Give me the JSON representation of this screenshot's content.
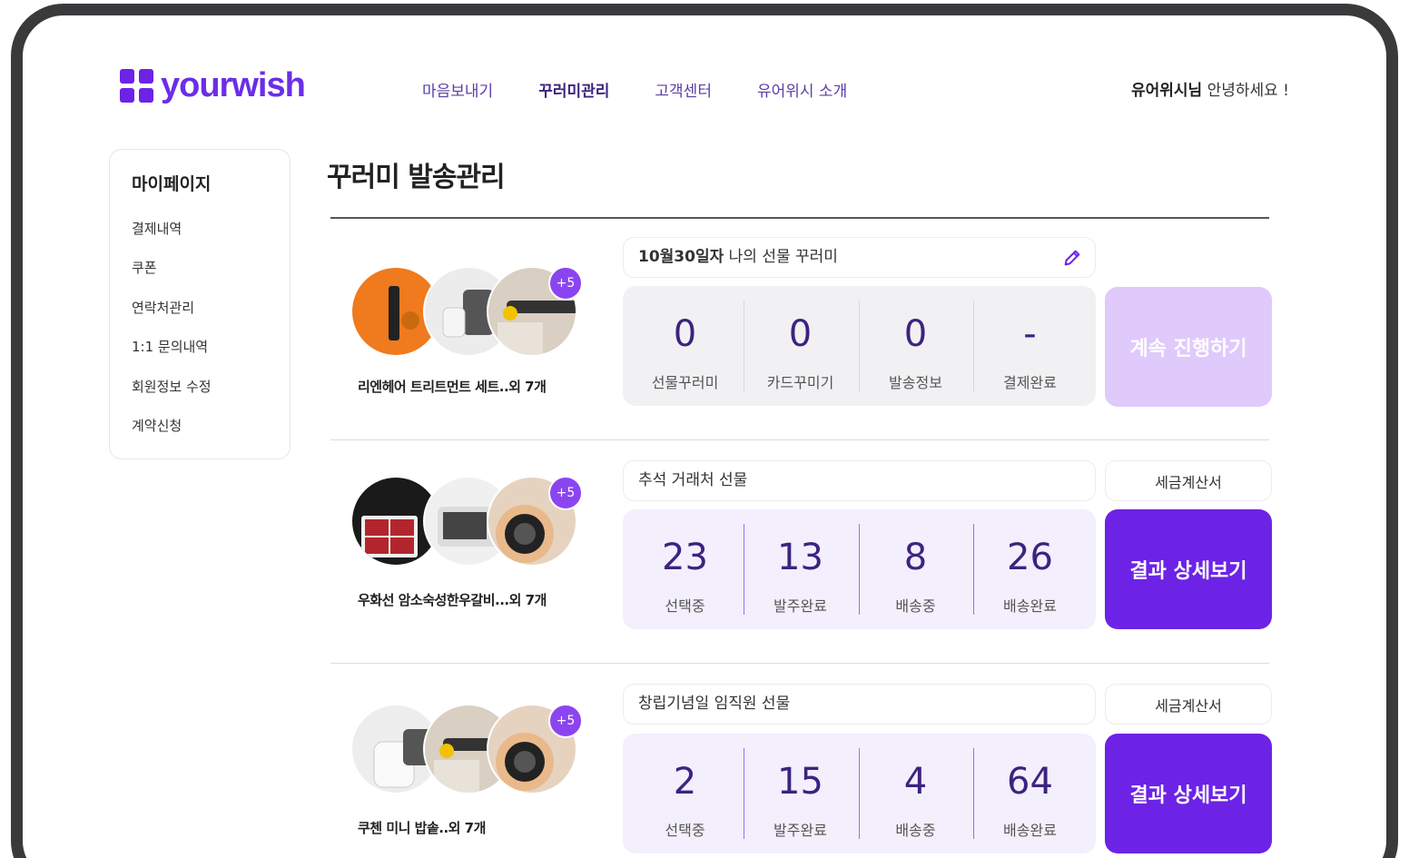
{
  "brand": {
    "name": "yourwish",
    "accent": "#6c23e6",
    "light_accent": "#e0c9fb"
  },
  "nav": {
    "items": [
      "마음보내기",
      "꾸러미관리",
      "고객센터",
      "유어위시 소개"
    ],
    "active": "꾸러미관리"
  },
  "greeting": {
    "name": "유어위시님",
    "text": "안녕하세요 !"
  },
  "sidebar": {
    "title": "마이페이지",
    "items": [
      "결제내역",
      "쿠폰",
      "연락처관리",
      "1:1 문의내역",
      "회원정보 수정",
      "계약신청"
    ]
  },
  "page": {
    "title": "꾸러미 발송관리"
  },
  "packages": [
    {
      "name_bold": "10월30일자",
      "name_rest": " 나의 선물 꾸러미",
      "product": "리엔헤어 트리트먼트 세트..외 7개",
      "extra_count": "+5",
      "stats": [
        {
          "value": "0",
          "label": "선물꾸러미"
        },
        {
          "value": "0",
          "label": "카드꾸미기"
        },
        {
          "value": "0",
          "label": "발송정보"
        },
        {
          "value": "-",
          "label": "결제완료"
        }
      ],
      "action": "계속 진행하기",
      "tax": ""
    },
    {
      "name_bold": "",
      "name_rest": "추석 거래처 선물",
      "product": "우화선 암소숙성한우갈비...외 7개",
      "extra_count": "+5",
      "stats": [
        {
          "value": "23",
          "label": "선택중"
        },
        {
          "value": "13",
          "label": "발주완료"
        },
        {
          "value": "8",
          "label": "배송중"
        },
        {
          "value": "26",
          "label": "배송완료"
        }
      ],
      "action": "결과 상세보기",
      "tax": "세금계산서"
    },
    {
      "name_bold": "",
      "name_rest": "창립기념일 임직원 선물",
      "product": "쿠첸 미니 밥솥..외 7개",
      "extra_count": "+5",
      "stats": [
        {
          "value": "2",
          "label": "선택중"
        },
        {
          "value": "15",
          "label": "발주완료"
        },
        {
          "value": "4",
          "label": "배송중"
        },
        {
          "value": "64",
          "label": "배송완료"
        }
      ],
      "action": "결과 상세보기",
      "tax": "세금계산서"
    }
  ]
}
